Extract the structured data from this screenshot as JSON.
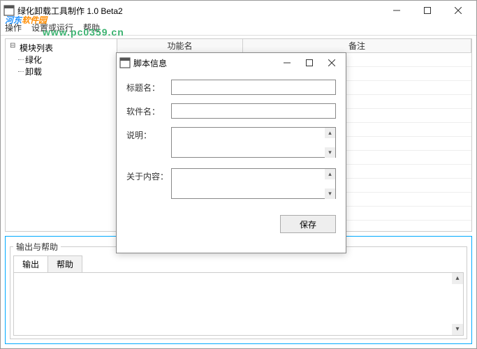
{
  "window": {
    "title": "绿化卸载工具制作 1.0 Beta2"
  },
  "menu": {
    "file": "操作",
    "options": "设置或运行",
    "help": "帮助"
  },
  "tree": {
    "root": "模块列表",
    "child1": "绿化",
    "child2": "卸载"
  },
  "grid": {
    "col1": "功能名",
    "col2": "备注"
  },
  "dialog": {
    "title": "脚本信息",
    "label_title": "标题名：",
    "label_software": "软件名：",
    "label_desc": "说明：",
    "label_about": "关于内容：",
    "value_title": "",
    "value_software": "",
    "value_desc": "",
    "value_about": "",
    "save": "保存"
  },
  "output_panel": {
    "legend": "输出与帮助",
    "tab_output": "输出",
    "tab_help": "帮助"
  },
  "watermark": {
    "brand_prefix": "河东",
    "brand_suffix": "软件园",
    "url": "www.pc0359.cn"
  }
}
